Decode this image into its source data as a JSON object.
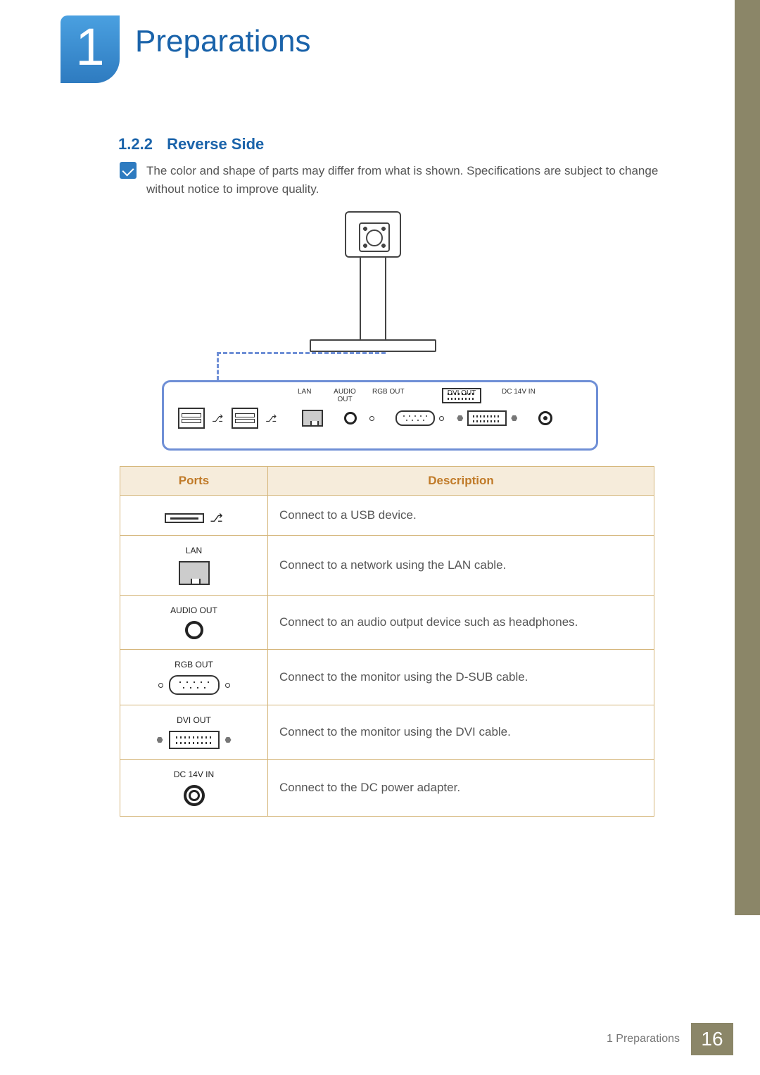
{
  "chapter": {
    "number": "1",
    "title": "Preparations"
  },
  "subsection": {
    "number": "1.2.2",
    "title": "Reverse Side"
  },
  "note": "The color and shape of parts may differ from what is shown. Specifications are subject to change without notice to improve quality.",
  "panel_labels": {
    "lan": "LAN",
    "audio": "AUDIO OUT",
    "rgb": "RGB OUT",
    "dvi": "DVI OUT",
    "dc": "DC 14V IN"
  },
  "table": {
    "headers": {
      "ports": "Ports",
      "description": "Description"
    },
    "rows": [
      {
        "label": "",
        "desc": "Connect to a USB device."
      },
      {
        "label": "LAN",
        "desc": "Connect to a network using the LAN cable."
      },
      {
        "label": "AUDIO OUT",
        "desc": "Connect to an audio output device such as headphones."
      },
      {
        "label": "RGB OUT",
        "desc": "Connect to the monitor using the D-SUB cable."
      },
      {
        "label": "DVI OUT",
        "desc": "Connect to the monitor using the DVI cable."
      },
      {
        "label": "DC 14V IN",
        "desc": "Connect to the DC power adapter."
      }
    ]
  },
  "footer": {
    "text": "1 Preparations",
    "page": "16"
  }
}
